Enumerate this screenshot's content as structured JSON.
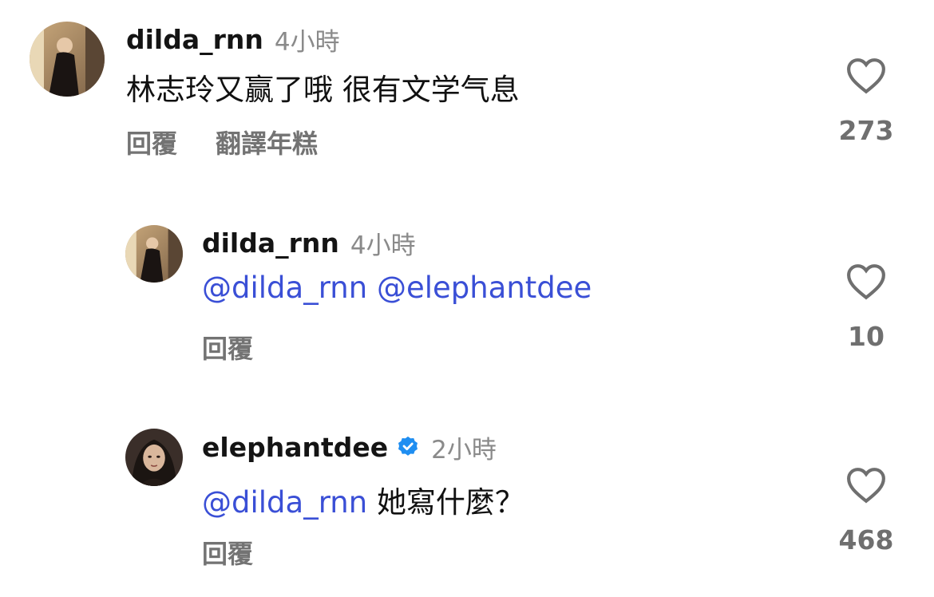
{
  "comments": [
    {
      "username": "dilda_rnn",
      "time": "4小時",
      "text": "林志玲又赢了哦 很有文学气息",
      "actions": {
        "reply": "回覆",
        "translate": "翻譯年糕"
      },
      "likes": "273",
      "avatar_icon": "user-photo-dark-dress"
    },
    {
      "username": "dilda_rnn",
      "time": "4小時",
      "mention1": "@dilda_rnn",
      "mention2": "@elephantdee",
      "actions": {
        "reply": "回覆"
      },
      "likes": "10",
      "avatar_icon": "user-photo-dark-dress"
    },
    {
      "username": "elephantdee",
      "verified": true,
      "time": "2小時",
      "mention": "@dilda_rnn",
      "text": "她寫什麼？",
      "actions": {
        "reply": "回覆"
      },
      "likes": "468",
      "avatar_icon": "user-photo-portrait"
    }
  ],
  "colors": {
    "mention": "#3a4fd6",
    "verified": "#1f8ef1",
    "muted": "#8a8a8a",
    "icon": "#6f6f6f"
  }
}
